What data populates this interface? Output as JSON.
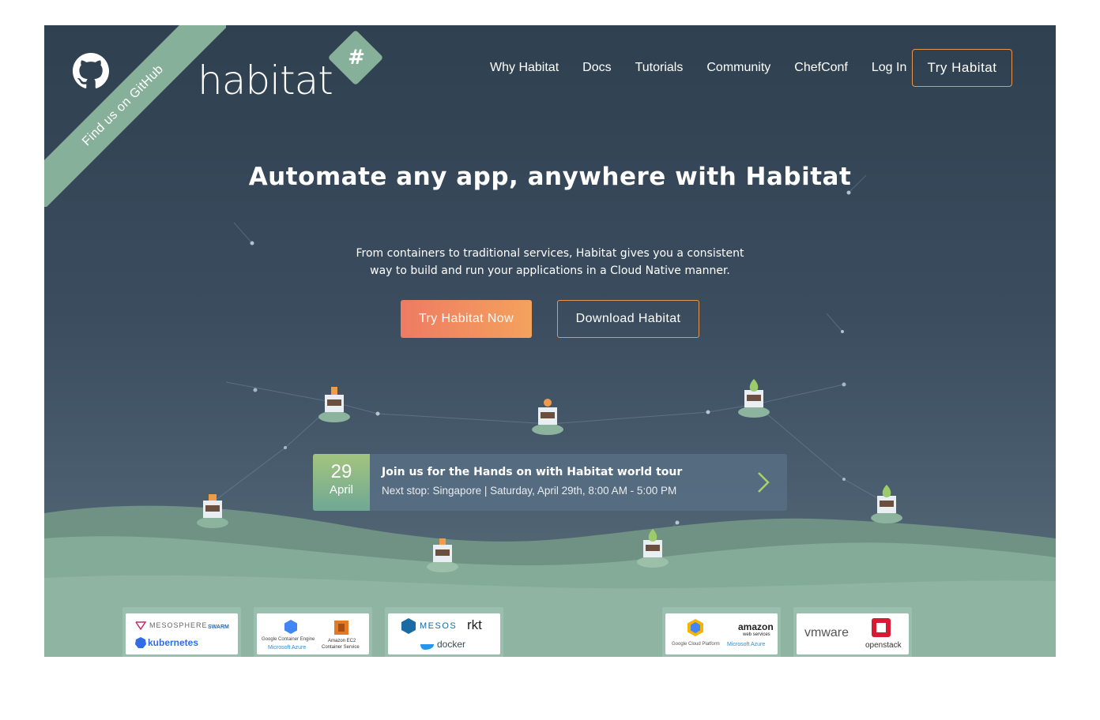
{
  "github_ribbon": {
    "label": "Find us on GitHub"
  },
  "logo": {
    "text": "habitat"
  },
  "nav": {
    "items": [
      {
        "label": "Why Habitat"
      },
      {
        "label": "Docs"
      },
      {
        "label": "Tutorials"
      },
      {
        "label": "Community"
      },
      {
        "label": "ChefConf"
      },
      {
        "label": "Log In"
      }
    ],
    "cta": "Try Habitat"
  },
  "hero": {
    "headline": "Automate any app, anywhere with Habitat",
    "subtext": "From containers to traditional services, Habitat gives you a consistent way to build and run your applications in a Cloud Native manner.",
    "primary_button": "Try Habitat Now",
    "secondary_button": "Download Habitat"
  },
  "event": {
    "day": "29",
    "month": "April",
    "title": "Join us for the Hands on with Habitat world tour",
    "details": "Next stop: Singapore | Saturday, April 29th, 8:00 AM - 5:00 PM"
  },
  "platforms": [
    {
      "logos": [
        "MESOSPHERE",
        "kubernetes",
        "SWARM"
      ]
    },
    {
      "logos": [
        "Google Container Engine",
        "Microsoft Azure",
        "Amazon EC2",
        "Container Service"
      ]
    },
    {
      "logos": [
        "MESOS",
        "rkt",
        "docker"
      ]
    },
    {
      "logos": [
        "Google Cloud Platform",
        "Microsoft Azure",
        "amazon",
        "web services"
      ]
    },
    {
      "logos": [
        "vmware",
        "openstack"
      ]
    }
  ],
  "colors": {
    "accent_green": "#87b09a",
    "accent_orange": "#e8964f",
    "hero_top": "#2f4150"
  }
}
